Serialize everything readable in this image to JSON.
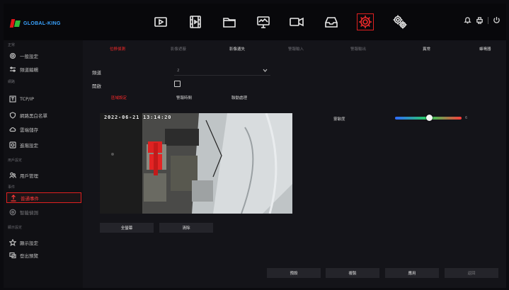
{
  "brand": {
    "name": "GLOBAL-KING"
  },
  "top_nav": [
    {
      "icon": "playback-icon"
    },
    {
      "icon": "film-icon"
    },
    {
      "icon": "folder-icon"
    },
    {
      "icon": "monitor-icon"
    },
    {
      "icon": "camera-icon"
    },
    {
      "icon": "storage-icon"
    },
    {
      "icon": "settings-gear-icon",
      "active": true
    },
    {
      "icon": "system-gear-icon"
    }
  ],
  "top_right": {
    "icons": [
      "bell-icon",
      "printer-icon",
      "power-icon"
    ]
  },
  "sidebar": {
    "groups": {
      "general": "正常",
      "network": "網路",
      "user": "用戶設定",
      "event": "事件",
      "display": "顯示設定"
    },
    "items": [
      {
        "label": "一般設定",
        "icon": "gear-outline-icon"
      },
      {
        "label": "頻道編輯",
        "icon": "sliders-icon"
      },
      {
        "label": "TCP/IP",
        "icon": "tcpip-icon"
      },
      {
        "label": "網路黑白名單",
        "icon": "shield-icon"
      },
      {
        "label": "雲端儲存",
        "icon": "cloud-icon"
      },
      {
        "label": "進階設定",
        "icon": "advanced-icon"
      },
      {
        "label": "用戶管理",
        "icon": "users-icon"
      },
      {
        "label": "普通事件",
        "icon": "upload-icon",
        "active": true
      },
      {
        "label": "智能偵測",
        "icon": "smart-icon",
        "dim": true
      },
      {
        "label": "顯示設定",
        "icon": "star-icon"
      },
      {
        "label": "登出預覽",
        "icon": "preview-icon"
      }
    ]
  },
  "tabs": [
    "位移偵測",
    "影像遮蔽",
    "影像遺失",
    "警報輸入",
    "警報輸出",
    "異常",
    "蜂鳴器"
  ],
  "form": {
    "channel_label": "頻道",
    "channel_value": "2",
    "enable_label": "開啟"
  },
  "subtabs": [
    "區域設定",
    "警報時間",
    "聯動處理"
  ],
  "video": {
    "osd_time": "2022-06-21 13:14:20"
  },
  "sensitivity": {
    "label": "靈敏度",
    "value_text": "6",
    "level": 0.52
  },
  "video_buttons": {
    "full_screen": "全螢幕",
    "clear": "清除"
  },
  "bottom_buttons": {
    "default": "預設",
    "copy": "複製",
    "apply": "應用",
    "cancel": "返回"
  },
  "colors": {
    "accent": "#e02020",
    "slider_left": "#2f6bff",
    "slider_mid": "#29d35a",
    "slider_right": "#ff3b3b"
  }
}
